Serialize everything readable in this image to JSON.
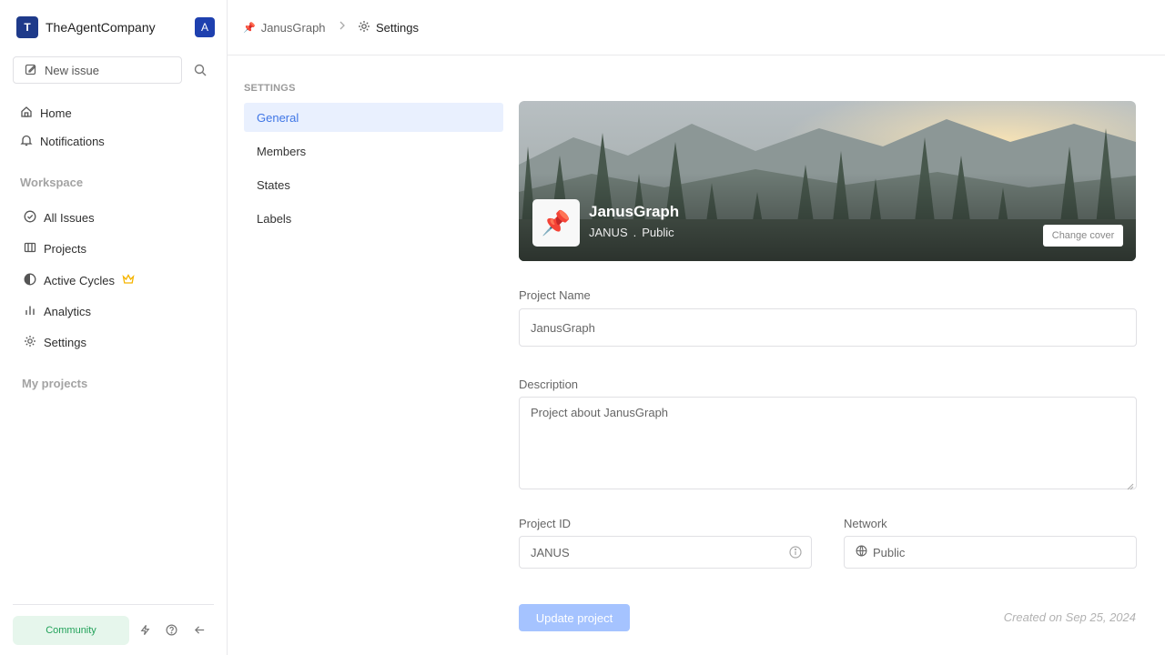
{
  "sidebar": {
    "workspace": {
      "logo_letter": "T",
      "name": "TheAgentCompany",
      "user_initial": "A"
    },
    "new_issue_label": "New issue",
    "nav": {
      "home": "Home",
      "notifications": "Notifications"
    },
    "workspace_section": "Workspace",
    "workspace_items": {
      "all_issues": "All Issues",
      "projects": "Projects",
      "active_cycles": "Active Cycles",
      "analytics": "Analytics",
      "settings": "Settings"
    },
    "my_projects_section": "My projects",
    "community_label": "Community"
  },
  "header": {
    "breadcrumb_project": "JanusGraph",
    "breadcrumb_settings": "Settings"
  },
  "settings_nav": {
    "title": "SETTINGS",
    "general": "General",
    "members": "Members",
    "states": "States",
    "labels": "Labels"
  },
  "cover": {
    "project_emoji": "📌",
    "project_name": "JanusGraph",
    "identifier": "JANUS",
    "separator": ".",
    "visibility": "Public",
    "change_cover_label": "Change cover"
  },
  "form": {
    "project_name_label": "Project Name",
    "project_name_value": "JanusGraph",
    "description_label": "Description",
    "description_value": "Project about JanusGraph",
    "project_id_label": "Project ID",
    "project_id_value": "JANUS",
    "network_label": "Network",
    "network_value": "Public",
    "update_label": "Update project",
    "created_text": "Created on Sep 25, 2024"
  },
  "colors": {
    "accent": "#3f76e6",
    "active_bg": "#e9f0fe",
    "update_button": "#a5c3ff",
    "community_bg": "#e6f6ec",
    "community_text": "#22a25a",
    "workspace_logo": "#1e3a8a",
    "crown": "#f5b400"
  }
}
